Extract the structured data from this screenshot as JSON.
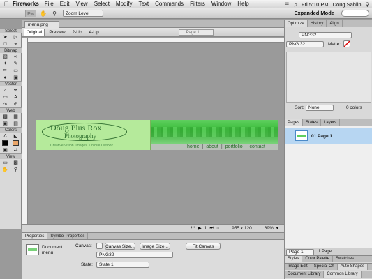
{
  "menubar": {
    "apple_icon": "apple-logo",
    "app_name": "Fireworks",
    "items": [
      "File",
      "Edit",
      "View",
      "Select",
      "Modify",
      "Text",
      "Commands",
      "Filters",
      "Window",
      "Help"
    ],
    "clock": "Fri 5:10 PM",
    "user": "Doug Sahlin"
  },
  "toolbar": {
    "logo": "Fw",
    "zoom_level": "Zoom Level",
    "mode": "Expanded Mode"
  },
  "tools": {
    "sections": [
      "Select",
      "Bitmap",
      "Vector",
      "Web",
      "Colors",
      "View"
    ]
  },
  "document": {
    "tab_name": "menu.png",
    "views": [
      "Original",
      "Preview",
      "2-Up",
      "4-Up"
    ],
    "page_select": "Page 1"
  },
  "canvas": {
    "logo_title": "Doug Plus Rox",
    "logo_subtitle": "Photography",
    "logo_tagline": "Creative Vision. Images. Unique Outlook.",
    "nav": [
      "home",
      "about",
      "portfolio",
      "contact"
    ],
    "colors": {
      "logo_bg": "#b5ea9b",
      "band": "#3bbd3b",
      "nav_text": "#2a6a2a"
    }
  },
  "status": {
    "page_num": "1",
    "size": "955 x 120",
    "zoom": "69%"
  },
  "properties": {
    "tabs": [
      "Properties",
      "Symbol Properties"
    ],
    "doc_label_line1": "Document",
    "doc_label_line2": "menu",
    "canvas_label": "Canvas:",
    "canvas_size_btn": "Canvas Size...",
    "image_size_btn": "Image Size...",
    "fit_canvas_btn": "Fit Canvas",
    "format": "PNG32",
    "state_label": "State:",
    "state_value": "State 1"
  },
  "right_panel": {
    "top_tabs": [
      "Optimize",
      "History",
      "Align"
    ],
    "preset": "PNG32",
    "format": "PNG 32",
    "matte_label": "Matte:",
    "sort_label": "Sort:",
    "sort_value": "None",
    "colors_count": "0 colors",
    "pages_tabs": [
      "Pages",
      "States",
      "Layers"
    ],
    "page_entry": "01  Page 1",
    "footer_page": "Page 1",
    "footer_count": "1 Page",
    "stack1": [
      "Styles",
      "Color Palette",
      "Swatches"
    ],
    "stack2": [
      "Image Edit",
      "Special Ch",
      "Auto Shapes"
    ],
    "stack3": [
      "Document Library",
      "Common Library"
    ]
  }
}
